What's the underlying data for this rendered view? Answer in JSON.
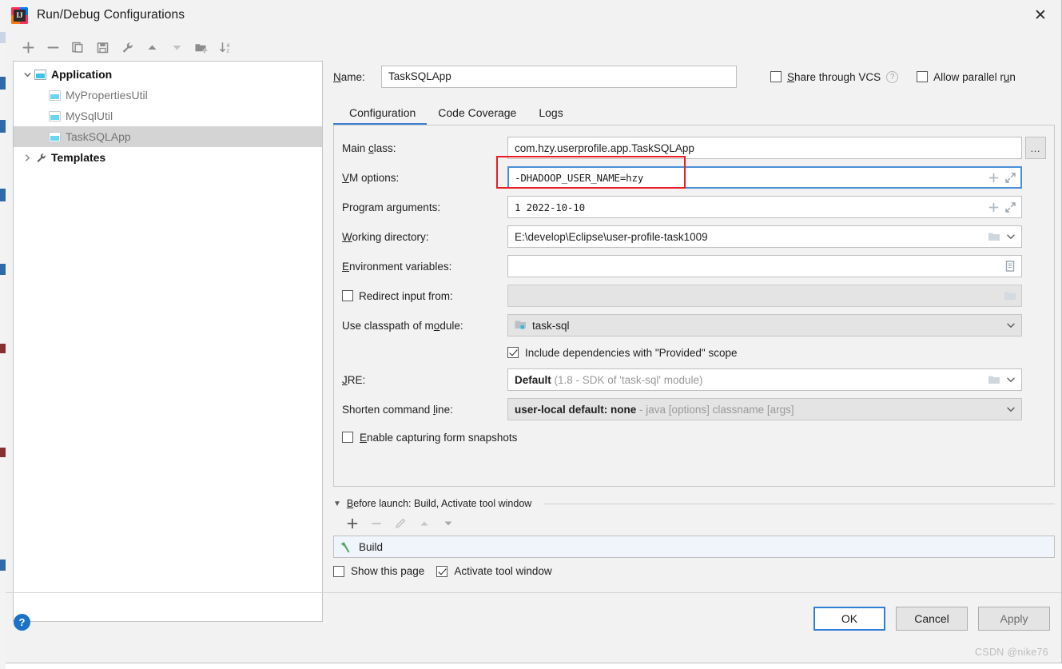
{
  "window": {
    "title": "Run/Debug Configurations",
    "app_icon": "intellij-idea-icon",
    "close_label": "✕"
  },
  "left_panel": {
    "toolbar": [
      {
        "name": "add-configuration-button",
        "glyph": "+"
      },
      {
        "name": "remove-configuration-button",
        "glyph": "−"
      },
      {
        "name": "copy-configuration-button",
        "glyph": "copy-icon"
      },
      {
        "name": "save-configuration-button",
        "glyph": "save-icon"
      },
      {
        "name": "edit-templates-button",
        "glyph": "wrench-icon"
      },
      {
        "name": "move-up-button",
        "glyph": "▲"
      },
      {
        "name": "move-down-button",
        "glyph": "▼"
      },
      {
        "name": "new-folder-button",
        "glyph": "folder-add-icon"
      },
      {
        "name": "sort-alphabetically-button",
        "glyph": "sort-az-icon"
      }
    ],
    "tree": [
      {
        "label": "Application",
        "type": "group",
        "expanded": true,
        "selected": false,
        "depth": 0
      },
      {
        "label": "MyPropertiesUtil",
        "type": "config",
        "selected": false,
        "depth": 1
      },
      {
        "label": "MySqlUtil",
        "type": "config",
        "selected": false,
        "depth": 1
      },
      {
        "label": "TaskSQLApp",
        "type": "config",
        "selected": true,
        "depth": 1
      },
      {
        "label": "Templates",
        "type": "templates",
        "expanded": false,
        "selected": false,
        "depth": 0
      }
    ]
  },
  "header": {
    "name_label": "Name:",
    "name_value": "TaskSQLApp",
    "share_through_vcs": {
      "label": "Share through VCS",
      "checked": false
    },
    "share_help_glyph": "?",
    "allow_parallel_run": {
      "label": "Allow parallel run",
      "checked": false
    }
  },
  "tabs": [
    {
      "label": "Configuration",
      "active": true
    },
    {
      "label": "Code Coverage",
      "active": false
    },
    {
      "label": "Logs",
      "active": false
    }
  ],
  "configuration": {
    "main_class": {
      "label": "Main class:",
      "value": "com.hzy.userprofile.app.TaskSQLApp",
      "browse_glyph": "…"
    },
    "vm_options": {
      "label": "VM options:",
      "value": "-DHADOOP_USER_NAME=hzy",
      "highlighted": true
    },
    "program_arguments": {
      "label": "Program arguments:",
      "value": "1  2022-10-10"
    },
    "working_directory": {
      "label": "Working directory:",
      "value": "E:\\develop\\Eclipse\\user-profile-task1009"
    },
    "environment_variables": {
      "label": "Environment variables:",
      "value": ""
    },
    "redirect_input_from": {
      "label": "Redirect input from:",
      "checked": false,
      "value": ""
    },
    "use_classpath_of_module": {
      "label": "Use classpath of module:",
      "value": "task-sql"
    },
    "include_provided_scope": {
      "label": "Include dependencies with \"Provided\" scope",
      "checked": true
    },
    "jre": {
      "label": "JRE:",
      "value": "Default",
      "value_hint": "(1.8 - SDK of 'task-sql' module)"
    },
    "shorten_command_line": {
      "label": "Shorten command line:",
      "value": "user-local default: none",
      "value_hint": "- java [options] classname [args]"
    },
    "enable_capturing_form_snapshots": {
      "label": "Enable capturing form snapshots",
      "checked": false
    }
  },
  "before_launch": {
    "header": "Before launch: Build, Activate tool window",
    "toolbar": [
      {
        "name": "add-task-button",
        "glyph": "+"
      },
      {
        "name": "remove-task-button",
        "glyph": "−"
      },
      {
        "name": "edit-task-button",
        "glyph": "pencil-icon"
      },
      {
        "name": "move-task-up-button",
        "glyph": "▲"
      },
      {
        "name": "move-task-down-button",
        "glyph": "▼"
      }
    ],
    "tasks": [
      {
        "label": "Build",
        "icon": "build-hammer-icon"
      }
    ],
    "show_this_page": {
      "label": "Show this page",
      "checked": false
    },
    "activate_tool_window": {
      "label": "Activate tool window",
      "checked": true
    }
  },
  "footer": {
    "help_glyph": "?",
    "ok_label": "OK",
    "cancel_label": "Cancel",
    "apply_label": "Apply"
  },
  "watermark": "CSDN @nike76",
  "colors": {
    "accent": "#3d7fd0",
    "annotation_red": "#ec1c24",
    "focus_blue": "#4a90d9",
    "selection_gray": "#d4d4d4",
    "build_green": "#59a869"
  }
}
